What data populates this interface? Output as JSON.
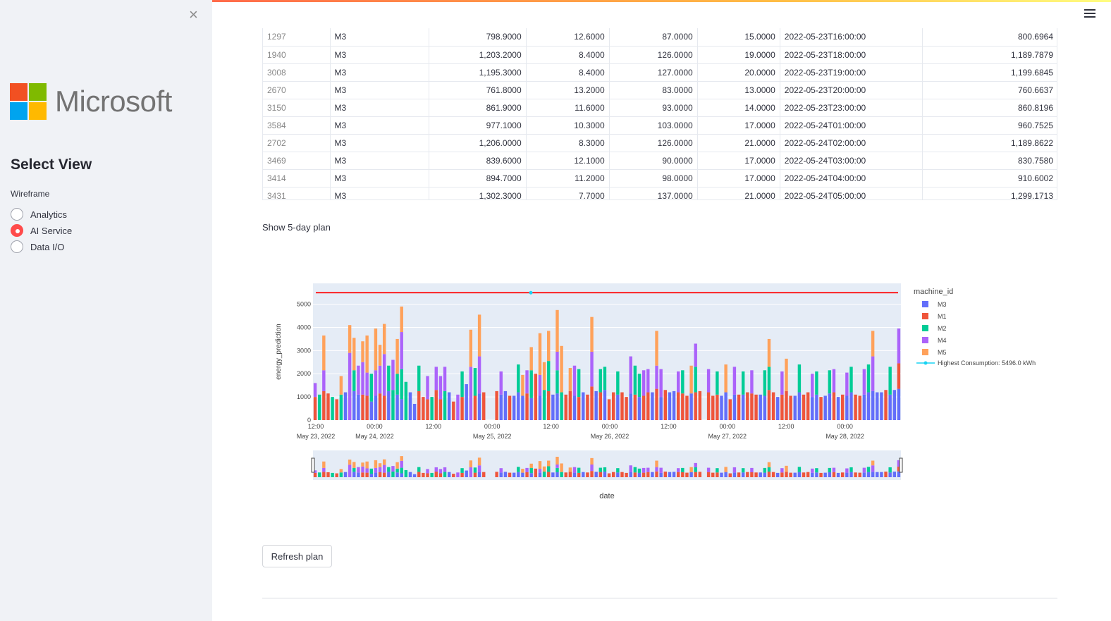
{
  "sidebar": {
    "close_glyph": "×",
    "logo_text": "Microsoft",
    "logo_colors": [
      "#f25022",
      "#7fba00",
      "#00a4ef",
      "#ffb900"
    ],
    "title": "Select View",
    "radio_group_label": "Wireframe",
    "options": [
      {
        "label": "Analytics",
        "selected": false
      },
      {
        "label": "AI Service",
        "selected": true
      },
      {
        "label": "Data I/O",
        "selected": false
      }
    ]
  },
  "table": {
    "rows": [
      [
        "1297",
        "M3",
        "798.9000",
        "12.6000",
        "87.0000",
        "15.0000",
        "2022-05-23T16:00:00",
        "800.6964"
      ],
      [
        "1940",
        "M3",
        "1,203.2000",
        "8.4000",
        "126.0000",
        "19.0000",
        "2022-05-23T18:00:00",
        "1,189.7879"
      ],
      [
        "3008",
        "M3",
        "1,195.3000",
        "8.4000",
        "127.0000",
        "20.0000",
        "2022-05-23T19:00:00",
        "1,199.6845"
      ],
      [
        "2670",
        "M3",
        "761.8000",
        "13.2000",
        "83.0000",
        "13.0000",
        "2022-05-23T20:00:00",
        "760.6637"
      ],
      [
        "3150",
        "M3",
        "861.9000",
        "11.6000",
        "93.0000",
        "14.0000",
        "2022-05-23T23:00:00",
        "860.8196"
      ],
      [
        "3584",
        "M3",
        "977.1000",
        "10.3000",
        "103.0000",
        "17.0000",
        "2022-05-24T01:00:00",
        "960.7525"
      ],
      [
        "2702",
        "M3",
        "1,206.0000",
        "8.3000",
        "126.0000",
        "21.0000",
        "2022-05-24T02:00:00",
        "1,189.8622"
      ],
      [
        "3469",
        "M3",
        "839.6000",
        "12.1000",
        "90.0000",
        "17.0000",
        "2022-05-24T03:00:00",
        "830.7580"
      ],
      [
        "3414",
        "M3",
        "894.7000",
        "11.2000",
        "98.0000",
        "17.0000",
        "2022-05-24T04:00:00",
        "910.6002"
      ],
      [
        "3431",
        "M3",
        "1,302.3000",
        "7.7000",
        "137.0000",
        "21.0000",
        "2022-05-24T05:00:00",
        "1,299.1713"
      ]
    ]
  },
  "plan_label": "Show 5-day plan",
  "refresh_label": "Refresh plan",
  "chart_data": {
    "type": "bar",
    "stacked": true,
    "xlabel": "date",
    "ylabel": "energy_prediction",
    "ylim": [
      0,
      5900
    ],
    "yticks": [
      0,
      1000,
      2000,
      3000,
      4000,
      5000
    ],
    "x_tick_labels": [
      [
        "12:00",
        "May 23, 2022"
      ],
      [
        "00:00",
        "May 24, 2022"
      ],
      [
        "12:00",
        ""
      ],
      [
        "00:00",
        "May 25, 2022"
      ],
      [
        "12:00",
        ""
      ],
      [
        "00:00",
        "May 26, 2022"
      ],
      [
        "12:00",
        ""
      ],
      [
        "00:00",
        "May 27, 2022"
      ],
      [
        "12:00",
        ""
      ],
      [
        "00:00",
        "May 28, 2022"
      ]
    ],
    "legend_title": "machine_id",
    "legend_position": "right",
    "series": [
      {
        "name": "M3",
        "color": "#636efa"
      },
      {
        "name": "M1",
        "color": "#ef553b"
      },
      {
        "name": "M2",
        "color": "#00cc96"
      },
      {
        "name": "M4",
        "color": "#ab63fa"
      },
      {
        "name": "M5",
        "color": "#ffa15a"
      }
    ],
    "bars": [
      [
        0,
        1000,
        0,
        600,
        0
      ],
      [
        0,
        0,
        1100,
        0,
        0
      ],
      [
        0,
        1250,
        0,
        900,
        1500
      ],
      [
        0,
        1150,
        0,
        0,
        0
      ],
      [
        0,
        0,
        1000,
        0,
        0
      ],
      [
        0,
        900,
        0,
        0,
        0
      ],
      [
        0,
        0,
        1100,
        0,
        800
      ],
      [
        1200,
        0,
        0,
        0,
        0
      ],
      [
        0,
        0,
        0,
        2900,
        1200
      ],
      [
        1250,
        0,
        900,
        0,
        1400
      ],
      [
        1100,
        0,
        0,
        1250,
        0
      ],
      [
        0,
        1100,
        0,
        1400,
        900
      ],
      [
        0,
        1050,
        0,
        1000,
        1600
      ],
      [
        800,
        0,
        1200,
        0,
        0
      ],
      [
        1050,
        0,
        0,
        1100,
        1800
      ],
      [
        0,
        1150,
        0,
        1200,
        900
      ],
      [
        0,
        1050,
        0,
        1800,
        1300
      ],
      [
        1250,
        0,
        1100,
        0,
        0
      ],
      [
        0,
        0,
        1300,
        1300,
        0
      ],
      [
        1100,
        0,
        900,
        0,
        1500
      ],
      [
        900,
        0,
        1300,
        1600,
        1100
      ],
      [
        0,
        0,
        1650,
        0,
        0
      ],
      [
        1200,
        0,
        0,
        0,
        0
      ],
      [
        700,
        0,
        0,
        0,
        0
      ],
      [
        0,
        1250,
        1100,
        0,
        0
      ],
      [
        0,
        1000,
        0,
        0,
        0
      ],
      [
        0,
        900,
        0,
        1000,
        0
      ],
      [
        0,
        0,
        1000,
        0,
        0
      ],
      [
        0,
        1300,
        0,
        1000,
        0
      ],
      [
        0,
        900,
        0,
        1000,
        0
      ],
      [
        0,
        0,
        1250,
        1050,
        0
      ],
      [
        1200,
        0,
        0,
        0,
        0
      ],
      [
        0,
        800,
        0,
        0,
        0
      ],
      [
        0,
        0,
        0,
        1100,
        0
      ],
      [
        0,
        1000,
        1100,
        0,
        0
      ],
      [
        1550,
        0,
        0,
        0,
        0
      ],
      [
        0,
        0,
        0,
        2300,
        1600
      ],
      [
        0,
        1050,
        1200,
        0,
        0
      ],
      [
        1150,
        0,
        0,
        1600,
        1800
      ],
      [
        0,
        1200,
        0,
        0,
        0
      ],
      [
        0,
        0,
        0,
        0,
        0
      ],
      [
        0,
        0,
        0,
        0,
        0
      ],
      [
        0,
        1250,
        0,
        0,
        0
      ],
      [
        1100,
        0,
        0,
        1000,
        0
      ],
      [
        1250,
        0,
        0,
        0,
        0
      ],
      [
        0,
        1050,
        0,
        0,
        0
      ],
      [
        1050,
        0,
        0,
        0,
        0
      ],
      [
        1200,
        0,
        1200,
        0,
        0
      ],
      [
        1050,
        0,
        0,
        0,
        900
      ],
      [
        0,
        1150,
        0,
        1000,
        0
      ],
      [
        950,
        0,
        1200,
        0,
        1000
      ],
      [
        0,
        2000,
        0,
        0,
        0
      ],
      [
        1050,
        0,
        0,
        900,
        1800
      ],
      [
        0,
        0,
        1300,
        0,
        1200
      ],
      [
        0,
        1250,
        1300,
        0,
        1300
      ],
      [
        1100,
        0,
        0,
        0,
        0
      ],
      [
        1150,
        0,
        1000,
        800,
        1800
      ],
      [
        0,
        0,
        1200,
        0,
        2000
      ],
      [
        0,
        1100,
        0,
        0,
        0
      ],
      [
        0,
        1250,
        0,
        0,
        1000
      ],
      [
        1050,
        0,
        0,
        1300,
        0
      ],
      [
        0,
        1000,
        1200,
        0,
        0
      ],
      [
        1200,
        0,
        0,
        0,
        0
      ],
      [
        0,
        1100,
        0,
        0,
        0
      ],
      [
        0,
        1450,
        0,
        1500,
        1500
      ],
      [
        1250,
        0,
        0,
        0,
        0
      ],
      [
        0,
        1200,
        1000,
        0,
        0
      ],
      [
        1300,
        0,
        1000,
        0,
        0
      ],
      [
        0,
        900,
        0,
        0,
        0
      ],
      [
        0,
        1200,
        0,
        0,
        0
      ],
      [
        1100,
        0,
        1000,
        0,
        0
      ],
      [
        0,
        1200,
        0,
        0,
        0
      ],
      [
        0,
        1000,
        0,
        0,
        0
      ],
      [
        1150,
        0,
        0,
        1600,
        0
      ],
      [
        0,
        1100,
        1250,
        0,
        0
      ],
      [
        1000,
        0,
        1000,
        0,
        0
      ],
      [
        0,
        1050,
        0,
        1100,
        0
      ],
      [
        0,
        1200,
        0,
        1000,
        0
      ],
      [
        1200,
        0,
        0,
        0,
        0
      ],
      [
        0,
        1350,
        0,
        1000,
        1500
      ],
      [
        1000,
        0,
        0,
        1200,
        0
      ],
      [
        0,
        1300,
        0,
        0,
        0
      ],
      [
        1200,
        0,
        0,
        0,
        0
      ],
      [
        1250,
        0,
        0,
        0,
        0
      ],
      [
        0,
        1200,
        0,
        900,
        0
      ],
      [
        0,
        1150,
        1000,
        0,
        0
      ],
      [
        0,
        1050,
        0,
        0,
        0
      ],
      [
        1150,
        0,
        0,
        0,
        1200
      ],
      [
        0,
        1200,
        1100,
        1000,
        0
      ],
      [
        0,
        1250,
        0,
        0,
        0
      ],
      [
        0,
        0,
        0,
        0,
        0
      ],
      [
        0,
        1200,
        0,
        1000,
        0
      ],
      [
        0,
        1050,
        0,
        0,
        0
      ],
      [
        0,
        1100,
        1000,
        0,
        0
      ],
      [
        1050,
        0,
        0,
        0,
        0
      ],
      [
        1200,
        0,
        0,
        0,
        1200
      ],
      [
        0,
        900,
        0,
        0,
        0
      ],
      [
        1100,
        0,
        0,
        1200,
        0
      ],
      [
        0,
        1100,
        0,
        0,
        0
      ],
      [
        1100,
        0,
        1000,
        0,
        0
      ],
      [
        0,
        1200,
        0,
        0,
        0
      ],
      [
        0,
        1150,
        0,
        1000,
        0
      ],
      [
        0,
        1100,
        0,
        0,
        0
      ],
      [
        1100,
        0,
        0,
        0,
        0
      ],
      [
        1050,
        0,
        1100,
        0,
        0
      ],
      [
        0,
        1300,
        1000,
        0,
        1200
      ],
      [
        0,
        1200,
        0,
        0,
        0
      ],
      [
        1000,
        0,
        0,
        0,
        0
      ],
      [
        0,
        1100,
        0,
        1000,
        0
      ],
      [
        0,
        1250,
        0,
        0,
        1400
      ],
      [
        0,
        1050,
        0,
        0,
        0
      ],
      [
        1050,
        0,
        0,
        0,
        0
      ],
      [
        1200,
        0,
        1200,
        0,
        0
      ],
      [
        0,
        1100,
        0,
        0,
        0
      ],
      [
        0,
        1200,
        0,
        0,
        0
      ],
      [
        1000,
        0,
        0,
        1000,
        0
      ],
      [
        1100,
        0,
        1000,
        0,
        0
      ],
      [
        0,
        1000,
        0,
        0,
        0
      ],
      [
        1050,
        0,
        0,
        0,
        0
      ],
      [
        1150,
        0,
        1000,
        0,
        0
      ],
      [
        0,
        1200,
        0,
        1000,
        0
      ],
      [
        1000,
        0,
        0,
        0,
        0
      ],
      [
        0,
        1100,
        0,
        0,
        0
      ],
      [
        1050,
        0,
        0,
        1000,
        0
      ],
      [
        1200,
        0,
        1100,
        0,
        0
      ],
      [
        0,
        1100,
        0,
        0,
        0
      ],
      [
        0,
        1050,
        0,
        0,
        0
      ],
      [
        1100,
        0,
        0,
        1100,
        0
      ],
      [
        1200,
        0,
        1200,
        0,
        0
      ],
      [
        1250,
        0,
        0,
        1500,
        1100
      ],
      [
        1200,
        0,
        0,
        0,
        0
      ],
      [
        1200,
        0,
        0,
        0,
        0
      ],
      [
        0,
        1300,
        0,
        0,
        0
      ],
      [
        1100,
        0,
        1200,
        0,
        0
      ],
      [
        1300,
        0,
        0,
        0,
        0
      ],
      [
        1350,
        1100,
        0,
        1500,
        0
      ]
    ],
    "reference_line": {
      "label": "Highest Consumption: 5496.0 kWh",
      "value": 5496.0,
      "color": "#ff0000"
    },
    "legend_marker_color": "#19d3f3",
    "has_range_slider": true
  }
}
